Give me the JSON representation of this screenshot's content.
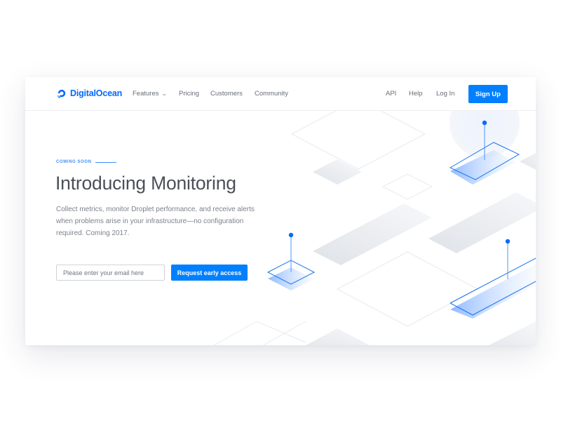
{
  "brand": {
    "name": "DigitalOcean",
    "logo_icon": "digitalocean-logo-icon",
    "accent_color": "#0080ff"
  },
  "nav": {
    "left_items": [
      {
        "label": "Features",
        "has_dropdown": true,
        "icon": "chevron-down-icon",
        "chevron": "⌄"
      },
      {
        "label": "Pricing"
      },
      {
        "label": "Customers"
      },
      {
        "label": "Community"
      }
    ],
    "right_items": [
      {
        "label": "API"
      },
      {
        "label": "Help"
      },
      {
        "label": "Log In"
      }
    ],
    "signup_label": "Sign Up"
  },
  "hero": {
    "eyebrow": "COMING SOON",
    "title": "Introducing Monitoring",
    "description": "Collect metrics, monitor Droplet performance, and receive alerts when problems arise in your infrastructure—no configuration required. Coming 2017.",
    "email_placeholder": "Please enter your email here",
    "email_value": "",
    "cta_label": "Request early access"
  },
  "illustration": {
    "description": "isometric monitoring illustration",
    "pins": 3
  }
}
